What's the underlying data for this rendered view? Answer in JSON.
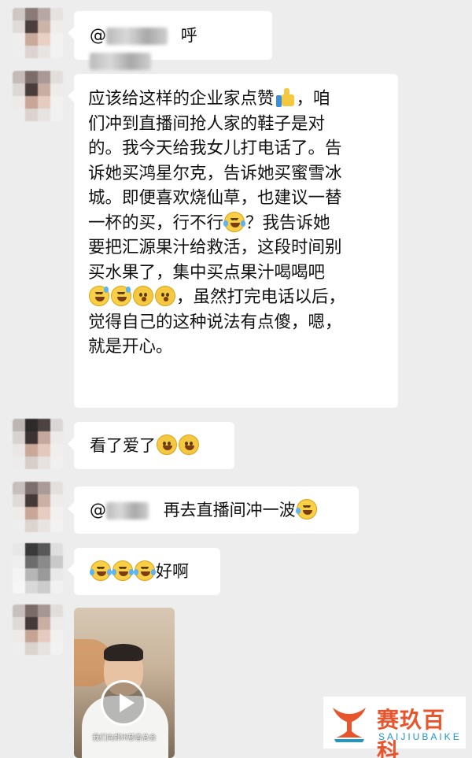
{
  "messages": [
    {
      "id": "m1",
      "mention_prefix": "@",
      "text": "呼",
      "type": "mention"
    },
    {
      "id": "m2",
      "lines": [
        "应该给这样的企业家点赞",
        "，咱",
        "们冲到直播间抢人家的鞋子是对",
        "的。我今天给我女儿打电话了。告",
        "诉她买鸿星尔克，告诉她买蜜雪冰",
        "城。即便喜欢烧仙草，也建议一替",
        "一杯的买，行不行",
        "？我告诉她",
        "要把汇源果汁给救活，这段时间别",
        "买水果了，集中买点果汁喝喝吧",
        "，虽然打完电话以后，",
        "觉得自己的这种说法有点傻，嗯，",
        "就是开心。"
      ],
      "emoji": [
        "thumbs-up-icon",
        "tears-of-joy-icon",
        "sweat-smile-icon",
        "flushed-icon"
      ]
    },
    {
      "id": "m3",
      "text": "看了爱了",
      "emoji": [
        "smile-icon",
        "smile-icon"
      ]
    },
    {
      "id": "m4",
      "mention_prefix": "@",
      "text": "再去直播间冲一波",
      "emoji": [
        "rofl-icon"
      ]
    },
    {
      "id": "m5",
      "text": "好啊",
      "emoji": [
        "tears-of-joy-icon",
        "tears-of-joy-icon",
        "tears-of-joy-icon"
      ]
    },
    {
      "id": "m6",
      "type": "video",
      "caption": "我们向郑州慈善总会"
    }
  ],
  "watermark": {
    "title": "赛玖百科",
    "subtitle": "SAIJIUBAIKE",
    "color_title": "#e8542c",
    "color_sub": "#1f97c7"
  },
  "colors": {
    "background": "#ededed",
    "bubble": "#ffffff"
  }
}
